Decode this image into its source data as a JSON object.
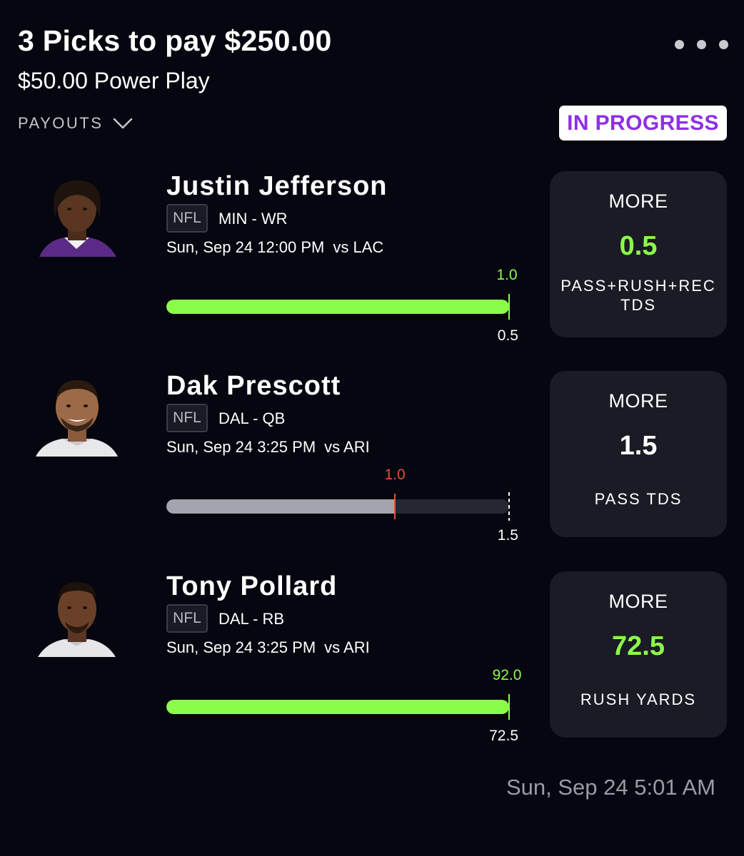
{
  "header": {
    "title": "3 Picks to pay $250.00",
    "subtitle": "$50.00 Power Play",
    "payouts_label": "PAYOUTS",
    "status": "IN PROGRESS"
  },
  "colors": {
    "background": "#05060f",
    "accent_green": "#8cfc4a",
    "accent_purple": "#8f2ee8",
    "miss_red": "#e84d3d",
    "card_bg": "#1a1b24"
  },
  "picks": [
    {
      "name": "Justin Jefferson",
      "league": "NFL",
      "team_pos": "MIN - WR",
      "game_day": "Sun, Sep 24 12:00 PM",
      "opponent": "vs LAC",
      "actual": "1.0",
      "line": "0.5",
      "progress_fraction": 1.0,
      "status": "hit",
      "direction": "MORE",
      "card_line": "0.5",
      "stat_line1": "PASS+RUSH+REC",
      "stat_line2": "TDS"
    },
    {
      "name": "Dak Prescott",
      "league": "NFL",
      "team_pos": "DAL - QB",
      "game_day": "Sun, Sep 24 3:25 PM",
      "opponent": "vs ARI",
      "actual": "1.0",
      "line": "1.5",
      "progress_fraction": 0.667,
      "status": "miss",
      "direction": "MORE",
      "card_line": "1.5",
      "stat_line1": "PASS TDS",
      "stat_line2": ""
    },
    {
      "name": "Tony Pollard",
      "league": "NFL",
      "team_pos": "DAL - RB",
      "game_day": "Sun, Sep 24 3:25 PM",
      "opponent": "vs ARI",
      "actual": "92.0",
      "line": "72.5",
      "progress_fraction": 1.0,
      "status": "hit",
      "direction": "MORE",
      "card_line": "72.5",
      "stat_line1": "RUSH YARDS",
      "stat_line2": ""
    }
  ],
  "footer": {
    "timestamp": "Sun, Sep 24 5:01 AM"
  }
}
